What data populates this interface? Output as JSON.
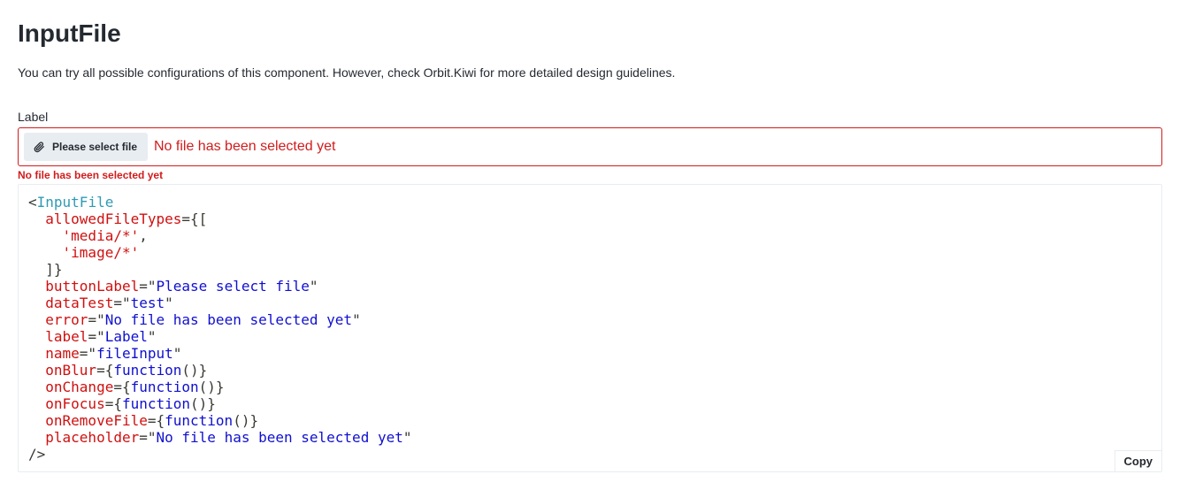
{
  "page": {
    "title": "InputFile",
    "description": "You can try all possible configurations of this component. However, check Orbit.Kiwi for more detailed design guidelines."
  },
  "input_file": {
    "label": "Label",
    "button_label": "Please select file",
    "button_icon": "attachment-icon",
    "placeholder": "No file has been selected yet",
    "error": "No file has been selected yet",
    "error_color": "#d21c1c"
  },
  "code": {
    "lines": [
      [
        {
          "t": "punct",
          "v": "<"
        },
        {
          "t": "tag",
          "v": "InputFile"
        }
      ],
      [
        {
          "t": "punct",
          "v": "  "
        },
        {
          "t": "attr",
          "v": "allowedFileTypes"
        },
        {
          "t": "punct",
          "v": "={["
        }
      ],
      [
        {
          "t": "punct",
          "v": "    "
        },
        {
          "t": "str",
          "v": "'media/*'"
        },
        {
          "t": "punct",
          "v": ","
        }
      ],
      [
        {
          "t": "punct",
          "v": "    "
        },
        {
          "t": "str",
          "v": "'image/*'"
        }
      ],
      [
        {
          "t": "punct",
          "v": "  ]}"
        }
      ],
      [
        {
          "t": "punct",
          "v": "  "
        },
        {
          "t": "attr",
          "v": "buttonLabel"
        },
        {
          "t": "punct",
          "v": "=\""
        },
        {
          "t": "val",
          "v": "Please select file"
        },
        {
          "t": "punct",
          "v": "\""
        }
      ],
      [
        {
          "t": "punct",
          "v": "  "
        },
        {
          "t": "attr",
          "v": "dataTest"
        },
        {
          "t": "punct",
          "v": "=\""
        },
        {
          "t": "val",
          "v": "test"
        },
        {
          "t": "punct",
          "v": "\""
        }
      ],
      [
        {
          "t": "punct",
          "v": "  "
        },
        {
          "t": "attr",
          "v": "error"
        },
        {
          "t": "punct",
          "v": "=\""
        },
        {
          "t": "val",
          "v": "No file has been selected yet"
        },
        {
          "t": "punct",
          "v": "\""
        }
      ],
      [
        {
          "t": "punct",
          "v": "  "
        },
        {
          "t": "attr",
          "v": "label"
        },
        {
          "t": "punct",
          "v": "=\""
        },
        {
          "t": "val",
          "v": "Label"
        },
        {
          "t": "punct",
          "v": "\""
        }
      ],
      [
        {
          "t": "punct",
          "v": "  "
        },
        {
          "t": "attr",
          "v": "name"
        },
        {
          "t": "punct",
          "v": "=\""
        },
        {
          "t": "val",
          "v": "fileInput"
        },
        {
          "t": "punct",
          "v": "\""
        }
      ],
      [
        {
          "t": "punct",
          "v": "  "
        },
        {
          "t": "attr",
          "v": "onBlur"
        },
        {
          "t": "punct",
          "v": "={"
        },
        {
          "t": "fn",
          "v": "function"
        },
        {
          "t": "punct",
          "v": "()}"
        }
      ],
      [
        {
          "t": "punct",
          "v": "  "
        },
        {
          "t": "attr",
          "v": "onChange"
        },
        {
          "t": "punct",
          "v": "={"
        },
        {
          "t": "fn",
          "v": "function"
        },
        {
          "t": "punct",
          "v": "()}"
        }
      ],
      [
        {
          "t": "punct",
          "v": "  "
        },
        {
          "t": "attr",
          "v": "onFocus"
        },
        {
          "t": "punct",
          "v": "={"
        },
        {
          "t": "fn",
          "v": "function"
        },
        {
          "t": "punct",
          "v": "()}"
        }
      ],
      [
        {
          "t": "punct",
          "v": "  "
        },
        {
          "t": "attr",
          "v": "onRemoveFile"
        },
        {
          "t": "punct",
          "v": "={"
        },
        {
          "t": "fn",
          "v": "function"
        },
        {
          "t": "punct",
          "v": "()}"
        }
      ],
      [
        {
          "t": "punct",
          "v": "  "
        },
        {
          "t": "attr",
          "v": "placeholder"
        },
        {
          "t": "punct",
          "v": "=\""
        },
        {
          "t": "val",
          "v": "No file has been selected yet"
        },
        {
          "t": "punct",
          "v": "\""
        }
      ],
      [
        {
          "t": "punct",
          "v": "/>"
        }
      ]
    ],
    "copy_label": "Copy"
  }
}
